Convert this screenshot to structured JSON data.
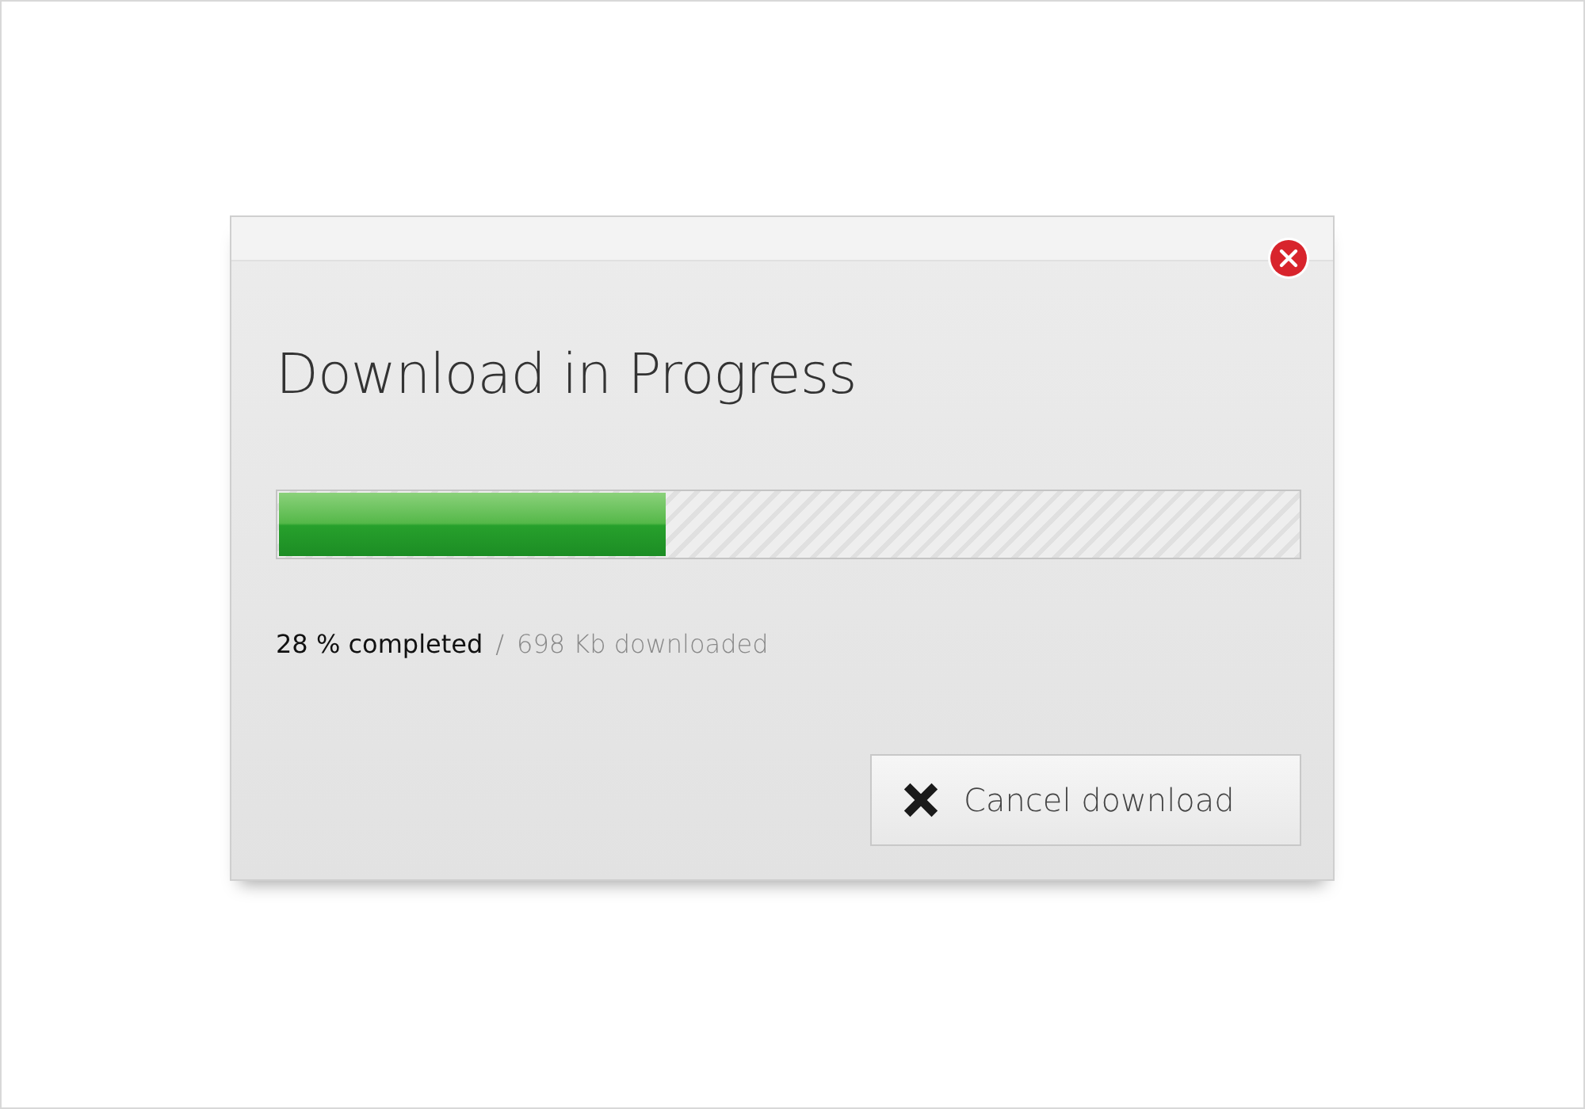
{
  "dialog": {
    "title": "Download in Progress",
    "progress": {
      "level": 0.38
    },
    "status": {
      "percent": "28 % completed",
      "separator": "/",
      "downloaded": "698 Kb downloaded"
    },
    "buttons": [
      {
        "kind": "cancel",
        "label": "Cancel download"
      }
    ]
  }
}
